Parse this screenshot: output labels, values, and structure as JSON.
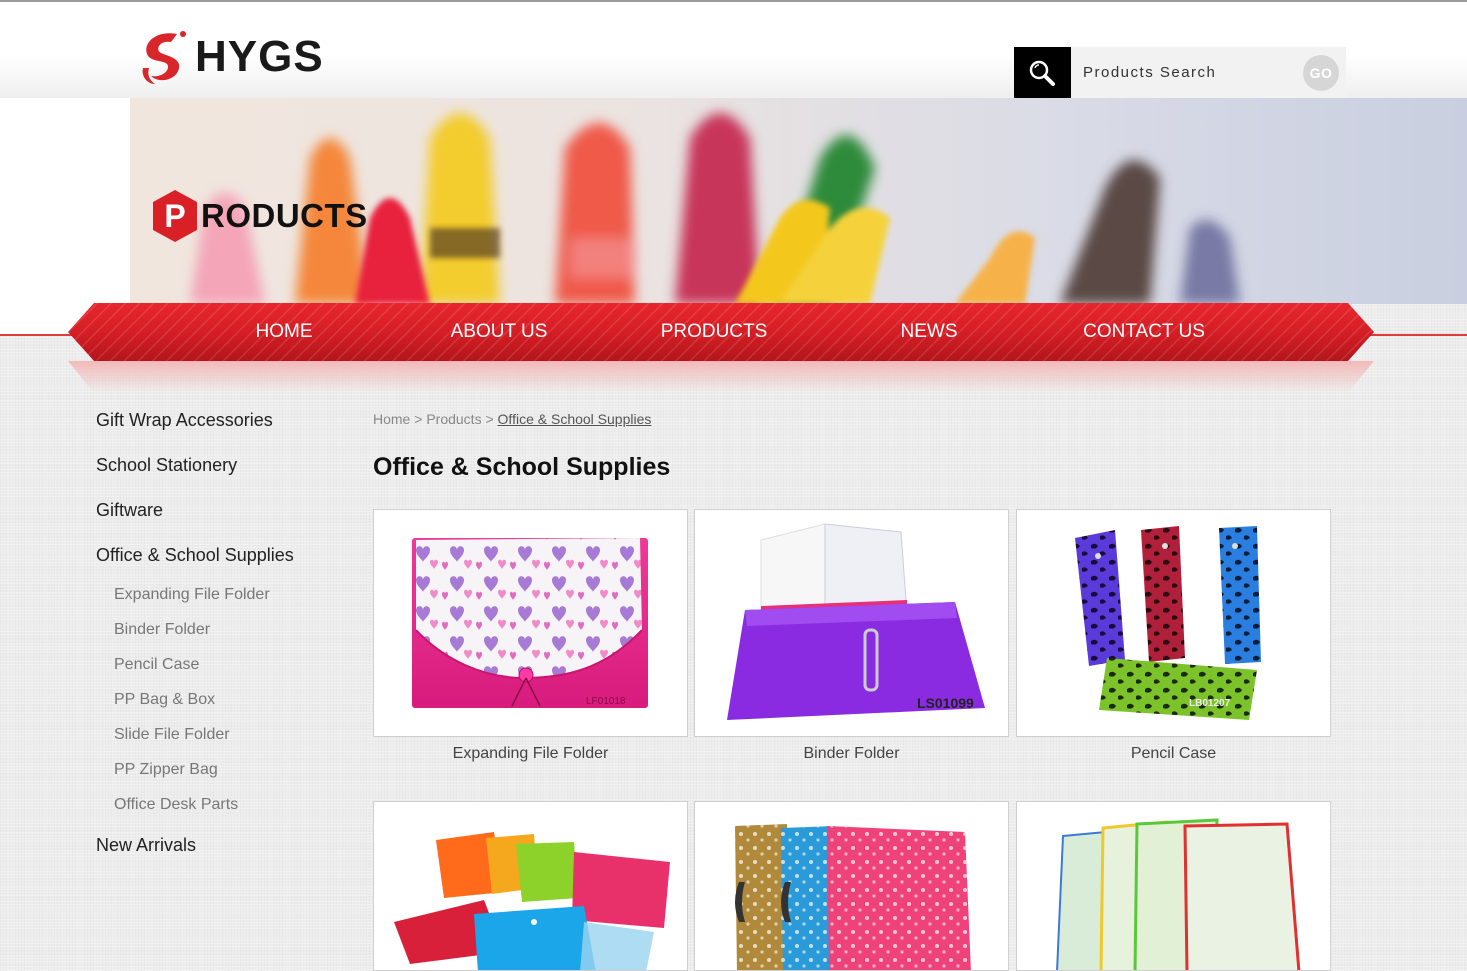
{
  "brand": {
    "name": "HYGS"
  },
  "search": {
    "placeholder": "Products Search",
    "go_label": "GO"
  },
  "banner": {
    "title_letter": "P",
    "title_rest": "RODUCTS"
  },
  "nav": {
    "items": [
      {
        "label": "HOME"
      },
      {
        "label": "ABOUT US"
      },
      {
        "label": "PRODUCTS"
      },
      {
        "label": "NEWS"
      },
      {
        "label": "CONTACT US"
      }
    ]
  },
  "sidebar": {
    "categories": [
      {
        "label": "Gift Wrap Accessories"
      },
      {
        "label": "School Stationery"
      },
      {
        "label": "Giftware"
      },
      {
        "label": "Office & School Supplies"
      },
      {
        "label": "New Arrivals"
      }
    ],
    "subcategories": [
      {
        "label": "Expanding File Folder"
      },
      {
        "label": "Binder Folder"
      },
      {
        "label": "Pencil Case"
      },
      {
        "label": "PP Bag & Box"
      },
      {
        "label": "Slide File Folder"
      },
      {
        "label": "PP Zipper Bag"
      },
      {
        "label": "Office Desk Parts"
      }
    ]
  },
  "breadcrumb": {
    "home": "Home",
    "sep": ">",
    "products": "Products",
    "current": "Office & School Supplies"
  },
  "page": {
    "heading": "Office & School Supplies"
  },
  "products": [
    {
      "name": "Expanding File Folder",
      "code": "LF01018"
    },
    {
      "name": "Binder Folder",
      "code": "LS01099"
    },
    {
      "name": "Pencil Case",
      "code": "LB01207"
    },
    {
      "name": "",
      "code": ""
    },
    {
      "name": "",
      "code": ""
    },
    {
      "name": "",
      "code": ""
    }
  ],
  "colors": {
    "accent_red": "#e0222a",
    "nav_red": "#d81f26",
    "search_bg": "#000000"
  }
}
